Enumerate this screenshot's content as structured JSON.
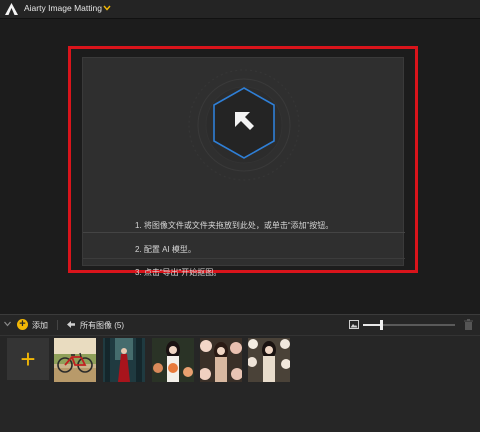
{
  "app": {
    "title": "Aiarty Image Matting",
    "logo_icon": "aiarty-logo-icon",
    "menu_icon": "chevron-down-icon",
    "accent_color": "#f2b705"
  },
  "drop_zone": {
    "import_icon": "arrow-up-left-icon",
    "highlight_color": "#d9141b",
    "icon_color": "#2f7fd6",
    "steps": [
      "1. 将图像文件或文件夹拖放到此处，或单击“添加”按钮。",
      "2. 配置 AI 模型。",
      "3. 点击“导出”开始抠图。"
    ]
  },
  "toolbar": {
    "add_label": "添加",
    "all_images_label": "所有图像 (5)",
    "thumbnail_size": 0.2
  },
  "thumbnails": [
    {
      "subject": "bicycle"
    },
    {
      "subject": "woman in red dress"
    },
    {
      "subject": "woman with flowers"
    },
    {
      "subject": "woman with flowers"
    },
    {
      "subject": "woman with flowers"
    }
  ]
}
